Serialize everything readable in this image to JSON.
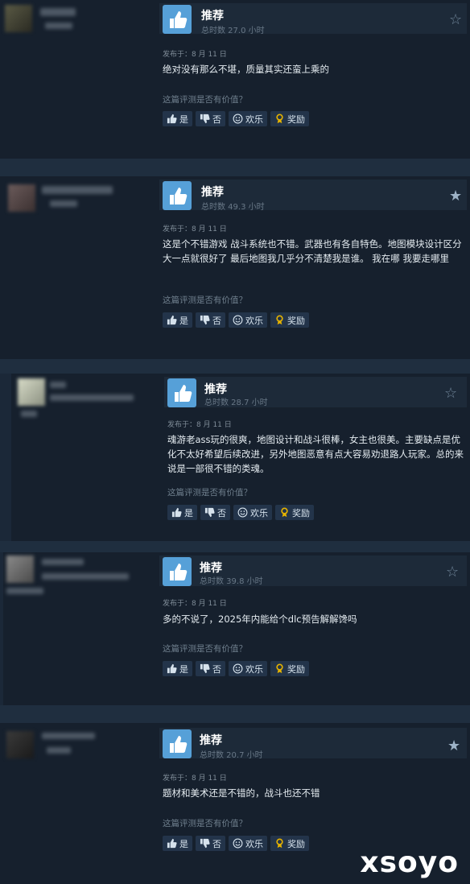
{
  "reviews": [
    {
      "title": "推荐",
      "hours": "总时数 27.0 小时",
      "date": "发布于：8 月 11 日",
      "text": "绝对没有那么不堪，质量其实还蛮上乘的",
      "star": "outline",
      "question": "这篇评测是否有价值？",
      "buttons": {
        "yes": "是",
        "no": "否",
        "funny": "欢乐",
        "award": "奖励"
      }
    },
    {
      "title": "推荐",
      "hours": "总时数 49.3 小时",
      "date": "发布于：8 月 11 日",
      "text": "这是个不错游戏 战斗系统也不错。武器也有各自特色。地图模块设计区分大一点就很好了 最后地图我几乎分不清楚我是谁。 我在哪 我要走哪里",
      "star": "filled",
      "question": "这篇评测是否有价值？",
      "buttons": {
        "yes": "是",
        "no": "否",
        "funny": "欢乐",
        "award": "奖励"
      }
    },
    {
      "title": "推荐",
      "hours": "总时数 28.7 小时",
      "date": "发布于：8 月 11 日",
      "text": "魂游老ass玩的很爽，地图设计和战斗很棒，女主也很美。主要缺点是优化不太好希望后续改进，另外地图恶意有点大容易劝退路人玩家。总的来说是一部很不错的类魂。",
      "star": "outline",
      "question": "这篇评测是否有价值？",
      "buttons": {
        "yes": "是",
        "no": "否",
        "funny": "欢乐",
        "award": "奖励"
      }
    },
    {
      "title": "推荐",
      "hours": "总时数 39.8 小时",
      "date": "发布于：8 月 11 日",
      "text": "多的不说了，2025年内能给个dlc预告解解馋吗",
      "star": "outline",
      "question": "这篇评测是否有价值？",
      "buttons": {
        "yes": "是",
        "no": "否",
        "funny": "欢乐",
        "award": "奖励"
      }
    },
    {
      "title": "推荐",
      "hours": "总时数 20.7 小时",
      "date": "发布于：8 月 11 日",
      "text": "题材和美术还是不错的，战斗也还不错",
      "star": "filled",
      "question": "这篇评测是否有价值？",
      "buttons": {
        "yes": "是",
        "no": "否",
        "funny": "欢乐",
        "award": "奖励"
      }
    }
  ],
  "watermark": "xsoyo",
  "icons": {
    "recommend": "thumbs-up-icon",
    "yes": "thumbs-up-icon",
    "no": "thumbs-down-icon",
    "funny": "smiley-icon",
    "award": "award-icon",
    "star": "star-icon"
  },
  "colors": {
    "accent": "#56a0d8",
    "background": "#1b2838",
    "award": "#e5b200"
  }
}
